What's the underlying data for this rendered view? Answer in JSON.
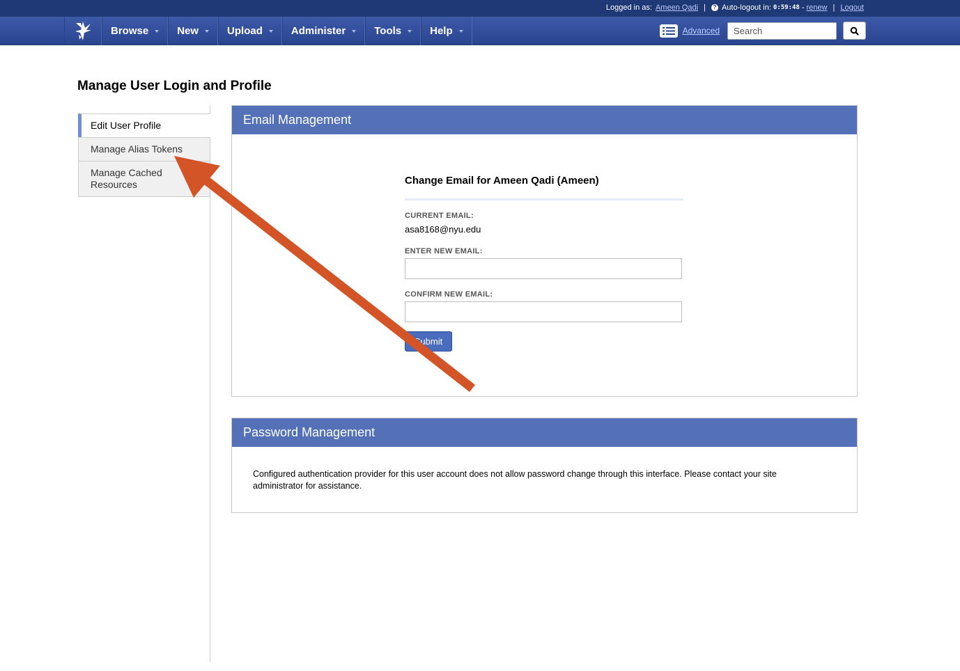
{
  "topbar": {
    "logged_in_label": "Logged in as:",
    "user_name": "Ameen Qadi",
    "separator": "|",
    "autologout_label": "Auto-logout in:",
    "timer": "0:59:48",
    "timer_dash": "-",
    "renew_label": "renew",
    "logout_label": "Logout"
  },
  "nav": {
    "items": [
      {
        "label": "Browse"
      },
      {
        "label": "New"
      },
      {
        "label": "Upload"
      },
      {
        "label": "Administer"
      },
      {
        "label": "Tools"
      },
      {
        "label": "Help"
      }
    ],
    "advanced_label": "Advanced",
    "search_placeholder": "Search",
    "icons": {
      "logo": "xnat-bird-logo",
      "advanced": "list-icon",
      "search": "search-icon"
    }
  },
  "page": {
    "title": "Manage User Login and Profile"
  },
  "sidebar": {
    "items": [
      {
        "label": "Edit User Profile",
        "active": true
      },
      {
        "label": "Manage Alias Tokens",
        "active": false
      },
      {
        "label": "Manage Cached Resources",
        "active": false
      }
    ]
  },
  "email_panel": {
    "header": "Email Management",
    "form_title": "Change Email for Ameen Qadi (Ameen)",
    "current_email_label": "CURRENT EMAIL:",
    "current_email": "asa8168@nyu.edu",
    "new_email_label": "ENTER NEW EMAIL:",
    "new_email_value": "",
    "confirm_email_label": "CONFIRM NEW EMAIL:",
    "confirm_email_value": "",
    "submit_label": "Submit"
  },
  "password_panel": {
    "header": "Password Management",
    "message": "Configured authentication provider for this user account does not allow password change through this interface. Please contact your site administrator for assistance."
  },
  "colors": {
    "nav_bg": "#2a4590",
    "top_strip": "#1f3876",
    "panel_header": "#5471b7",
    "annotation_arrow": "#d35427"
  }
}
